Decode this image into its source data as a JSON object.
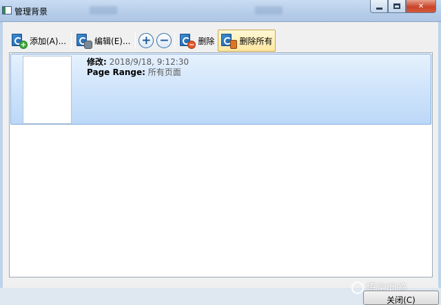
{
  "window": {
    "title": "管理背景"
  },
  "toolbar": {
    "add_label": "添加(A)...",
    "edit_label": "编辑(E)...",
    "zoom_in_glyph": "+",
    "zoom_out_glyph": "−",
    "delete_label": "删除",
    "delete_all_label": "删除所有"
  },
  "list": {
    "items": [
      {
        "modified_label": "修改:",
        "modified_value": "2018/9/18, 9:12:30",
        "range_label": "Page Range:",
        "range_value": "所有页面"
      }
    ]
  },
  "footer": {
    "close_label": "关闭(C)"
  },
  "watermark": {
    "text": "悟空问答"
  },
  "colors": {
    "selection": "#cfe4fb",
    "selection_border": "#84acdd",
    "active_button": "#fde8a0"
  }
}
